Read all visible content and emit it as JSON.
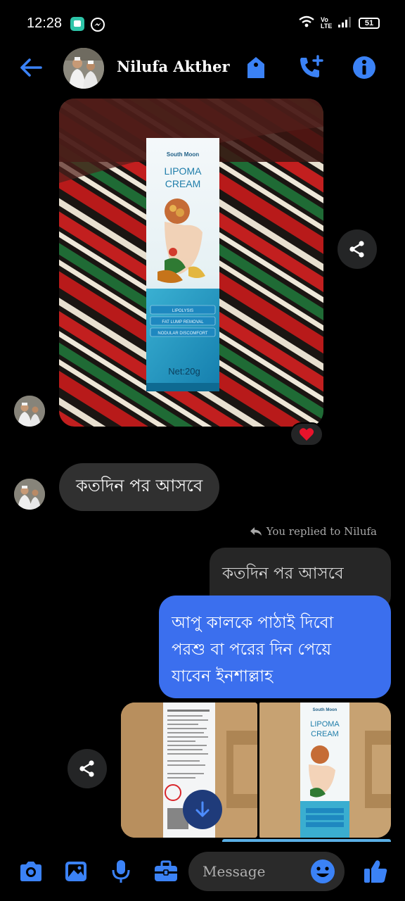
{
  "status_bar": {
    "time": "12:28",
    "network_label": "Vo LTE",
    "battery": "51"
  },
  "header": {
    "contact_name": "Nilufa Akther"
  },
  "messages": {
    "incoming_text": "কতদিন পর আসবে",
    "replied_to_label": "You replied to Nilufa",
    "quoted_text": "কতদিন পর আসবে",
    "outgoing_lines": [
      "আপু কালকে পাঠাই দিবো",
      "পরশু বা পরের দিন পেয়ে",
      "যাবেন ইনশাল্লাহ"
    ]
  },
  "product": {
    "brand": "South Moon",
    "name_line1": "LIPOMA",
    "name_line2": "CREAM",
    "features": [
      "LIPOLYSIS",
      "FAT LUMP REMOVAL",
      "NODULAR DISCOMFORT"
    ],
    "net_weight": "Net:20g"
  },
  "composer": {
    "placeholder": "Message"
  },
  "colors": {
    "accent": "#3b82f6",
    "outgoing_bubble": "#3b6fee",
    "incoming_bubble": "#303030",
    "reaction_heart": "#e8132b"
  }
}
